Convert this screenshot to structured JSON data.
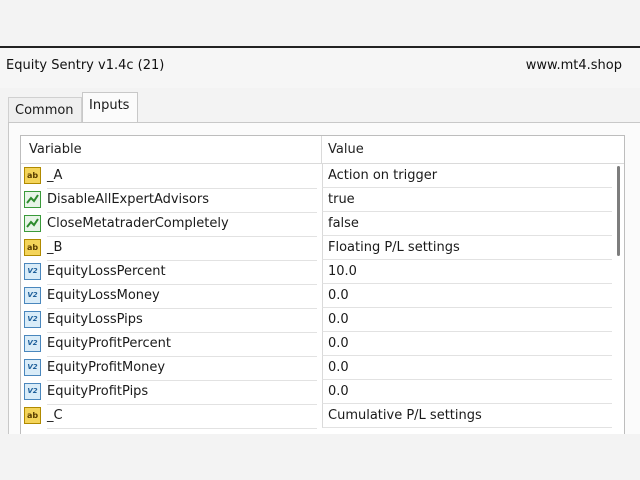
{
  "window": {
    "title": "Equity Sentry v1.4c (21)",
    "site": "www.mt4.shop"
  },
  "tabs": [
    {
      "label": "Common",
      "active": false
    },
    {
      "label": "Inputs",
      "active": true
    }
  ],
  "table": {
    "columns": [
      "Variable",
      "Value"
    ],
    "rows": [
      {
        "icon": "ab-icon",
        "variable": "_A",
        "value": "Action on trigger"
      },
      {
        "icon": "bool-icon",
        "variable": "DisableAllExpertAdvisors",
        "value": "true"
      },
      {
        "icon": "bool-icon",
        "variable": "CloseMetatraderCompletely",
        "value": "false"
      },
      {
        "icon": "ab-icon",
        "variable": "_B",
        "value": "Floating P/L settings"
      },
      {
        "icon": "number-icon",
        "variable": "EquityLossPercent",
        "value": "10.0"
      },
      {
        "icon": "number-icon",
        "variable": "EquityLossMoney",
        "value": "0.0"
      },
      {
        "icon": "number-icon",
        "variable": "EquityLossPips",
        "value": "0.0"
      },
      {
        "icon": "number-icon",
        "variable": "EquityProfitPercent",
        "value": "0.0"
      },
      {
        "icon": "number-icon",
        "variable": "EquityProfitMoney",
        "value": "0.0"
      },
      {
        "icon": "number-icon",
        "variable": "EquityProfitPips",
        "value": "0.0"
      },
      {
        "icon": "ab-icon",
        "variable": "_C",
        "value": "Cumulative P/L settings"
      }
    ]
  },
  "colors": {
    "ab_icon": "#f4d45a",
    "bool_icon": "#3a9a3a",
    "number_icon": "#4a87bd"
  }
}
